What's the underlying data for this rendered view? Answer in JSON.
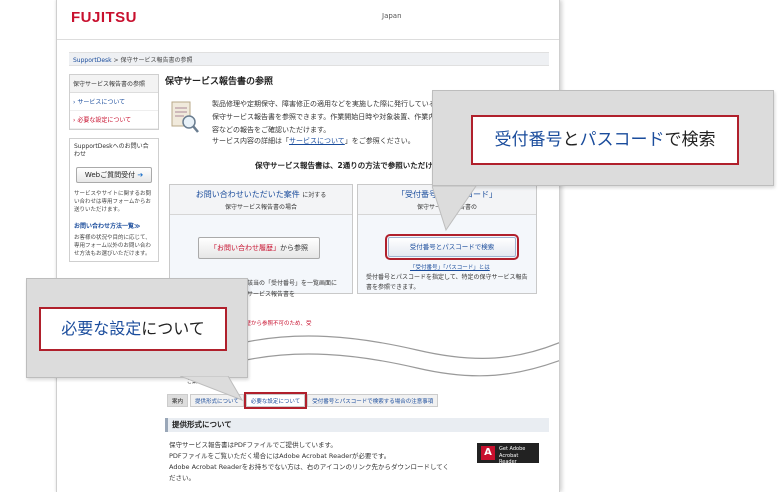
{
  "header": {
    "logo": "FUJITSU",
    "region": "Japan"
  },
  "breadcrumb": {
    "home": "SupportDesk",
    "sep": " > ",
    "current": "保守サービス報告書の参照"
  },
  "sidebar": {
    "head": "保守サービス報告書の参照",
    "links": [
      {
        "label": "サービスについて"
      },
      {
        "label": "必要な設定について"
      }
    ],
    "inquiry": {
      "title": "SupportDeskへのお問い合わせ",
      "web_button": "Webご質問受付",
      "desc": "サービスやサイトに関するお問い合わせは専用フォームからお送りいただけます。"
    },
    "methods": {
      "title": "お問い合わせ方法一覧≫",
      "desc": "お客様の状況や目的に応じて、専用フォーム以外のお問い合わせ方法もお選びいただけます。"
    }
  },
  "main": {
    "title": "保守サービス報告書の参照",
    "intro": "製品修理や定期保守、障害修正の適用などを実施した際に発行している保守サービス報告書を参照できます。作業開始日時や対象装置、作業内容などの報告をご確認いただけます。",
    "more_prefix": "サービス内容の詳細は「",
    "more_link": "サービスについて",
    "more_suffix": "」をご参照ください。",
    "methods_line": "保守サービス報告書は、2通りの方法で参照いただけます。"
  },
  "panel_left": {
    "title_main": "お問い合わせいただいた案件",
    "title_sub": "に対する",
    "subtitle": "保守サービス報告書の場合",
    "button_hl": "「お問い合わせ履歴」",
    "button_rest": "から参照",
    "desc": "から、該当の「受付番号」を一覧画面にて保守サービス報告書を",
    "warn": "合せ履歴から参照不可のため、受"
  },
  "panel_right": {
    "title": "「受付番号」「パスコード」",
    "subtitle": "保守サービス報告書の",
    "button": "受付番号とパスコードで検索",
    "link": "「受付番号」「パスコード」とは",
    "desc": "受付番号とパスコードを指定して、特定の保守サービス報告書を参照できます。"
  },
  "below_wave": {
    "fragment": "ご案内"
  },
  "tabs": [
    {
      "label": "案内"
    },
    {
      "label": "提供形式について"
    },
    {
      "label": "必要な設定について"
    },
    {
      "label": "受付番号とパスコードで検索する場合の注意事項"
    }
  ],
  "section": {
    "title": "提供形式について",
    "lines": [
      "保守サービス報告書はPDFファイルでご提供しています。",
      "PDFファイルをご覧いただく場合にはAdobe Acrobat Readerが必要です。",
      "Adobe Acrobat Readerをお持ちでない方は、右のアイコンのリンク先からダウンロードしてく",
      "ださい。"
    ]
  },
  "adobe": {
    "line1": "Get Adobe",
    "line2": "Acrobat Reader"
  },
  "callout_right": {
    "part1": "受付番号",
    "part2": "と",
    "part3": "パスコード",
    "part4": "で検索"
  },
  "callout_left": {
    "part1": "必要な設定",
    "part2": "について"
  },
  "colors": {
    "accent_red": "#b0202c",
    "link_blue": "#1a4c9c",
    "logo_red": "#c8102e"
  }
}
